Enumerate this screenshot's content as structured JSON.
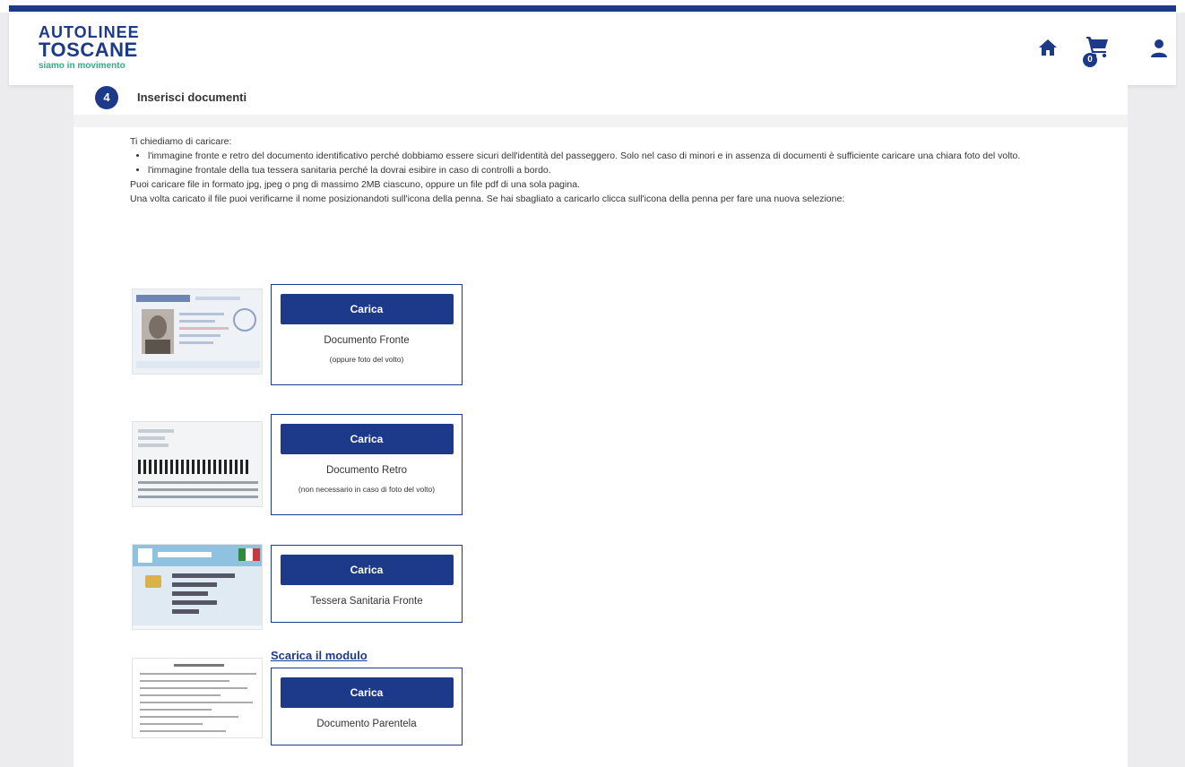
{
  "header": {
    "logo_line1": "AUTOLINEE",
    "logo_line2": "TOSCANE",
    "logo_tagline": "siamo in movimento",
    "cart_count": "0",
    "icons": [
      "home-icon",
      "cart-icon",
      "user-icon"
    ]
  },
  "colors": {
    "brand_blue": "#1d3a8a",
    "tagline_green": "#2eaf7d"
  },
  "step": {
    "number": "4",
    "title": "Inserisci documenti"
  },
  "intro": {
    "lead": "Ti chiediamo di caricare:",
    "bullets": [
      "l'immagine fronte e retro del documento identificativo perché dobbiamo essere sicuri dell'identità del passeggero. Solo nel caso di minori e in assenza di documenti è sufficiente caricare una chiara foto del volto.",
      "l'immagine frontale della tua tessera sanitaria perché la dovrai esibire in caso di controlli a bordo."
    ],
    "line1": "Puoi caricare file in formato jpg, jpeg o png di massimo 2MB ciascuno, oppure un file pdf di una sola pagina.",
    "line2": "Una volta caricato il file puoi verificarne il nome posizionandoti sull'icona della penna. Se hai sbagliato a caricarlo clicca sull'icona della penna per fare una nuova selezione:"
  },
  "uploads": [
    {
      "button": "Carica",
      "label": "Documento Fronte",
      "note": "(oppure foto del volto)"
    },
    {
      "button": "Carica",
      "label": "Documento Retro",
      "note": "(non necessario in caso di foto del volto)"
    },
    {
      "button": "Carica",
      "label": "Tessera Sanitaria Fronte",
      "note": ""
    },
    {
      "button": "Carica",
      "label": "Documento Parentela",
      "note": ""
    }
  ],
  "download_link": "Scarica il modulo"
}
